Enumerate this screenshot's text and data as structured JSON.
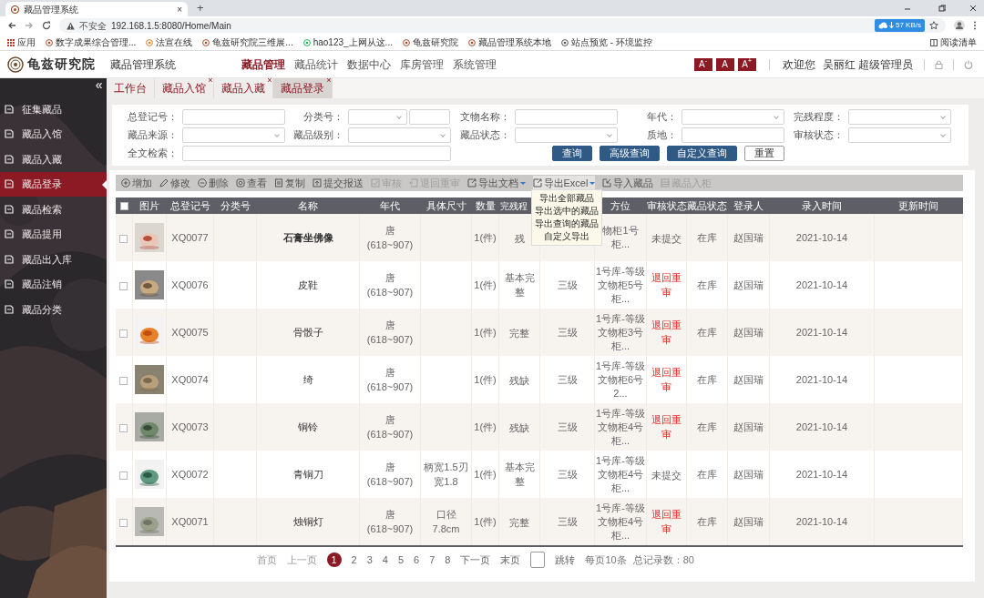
{
  "browser": {
    "tab_title": "藏品管理系统",
    "tab_close": "×",
    "new_tab": "+",
    "security": "不安全",
    "url": "192.168.1.5:8080/Home/Main",
    "speed": "57 KB/s",
    "bookmarks": [
      "应用",
      "数字成果综合管理...",
      "法宣在线",
      "龟兹研究院三维展...",
      "hao123_上网从这...",
      "龟兹研究院",
      "藏品管理系统本地",
      "站点预览 - 环境监控"
    ],
    "reading_list": "阅读清单"
  },
  "header": {
    "logo": "龟兹研究院",
    "system_name": "藏品管理系统",
    "nav": [
      {
        "label": "藏品管理",
        "selected": true
      },
      {
        "label": "藏品统计",
        "selected": false
      },
      {
        "label": "数据中心",
        "selected": false
      },
      {
        "label": "库房管理",
        "selected": false
      },
      {
        "label": "系统管理",
        "selected": false
      }
    ],
    "font_sizes": [
      "A$^{-}$",
      "A",
      "A$^{+}$"
    ],
    "welcome": "欢迎您",
    "user": "吴丽红 超级管理员"
  },
  "sidebar": {
    "collapse": "«",
    "items": [
      {
        "label": "征集藏品",
        "selected": false
      },
      {
        "label": "藏品入馆",
        "selected": false
      },
      {
        "label": "藏品入藏",
        "selected": false
      },
      {
        "label": "藏品登录",
        "selected": true
      },
      {
        "label": "藏品检索",
        "selected": false
      },
      {
        "label": "藏品提用",
        "selected": false
      },
      {
        "label": "藏品出入库",
        "selected": false
      },
      {
        "label": "藏品注销",
        "selected": false
      },
      {
        "label": "藏品分类",
        "selected": false
      }
    ]
  },
  "tabs": [
    {
      "label": "工作台",
      "selected": false
    },
    {
      "label": "藏品入馆",
      "selected": false,
      "close": "×"
    },
    {
      "label": "藏品入藏",
      "selected": false,
      "close": "×"
    },
    {
      "label": "藏品登录",
      "selected": true,
      "close": "×"
    }
  ],
  "filters": [
    {
      "label": "总登记号：",
      "kind": "text"
    },
    {
      "label": "分类号：",
      "kind": "select_text"
    },
    {
      "label": "文物名称：",
      "kind": "text"
    },
    {
      "label": "年代：",
      "kind": "select"
    },
    {
      "label": "完残程度：",
      "kind": "select"
    },
    {
      "label": "藏品来源：",
      "kind": "select"
    },
    {
      "label": "藏品级别：",
      "kind": "select"
    },
    {
      "label": "藏品状态：",
      "kind": "select"
    },
    {
      "label": "质地：",
      "kind": "text"
    },
    {
      "label": "审核状态：",
      "kind": "select"
    },
    {
      "label": "全文检索：",
      "kind": "wide"
    }
  ],
  "search_buttons": [
    {
      "label": "查询",
      "kind": "primary"
    },
    {
      "label": "高级查询",
      "kind": "primary"
    },
    {
      "label": "自定义查询",
      "kind": "primary"
    },
    {
      "label": "重置",
      "kind": "plain"
    }
  ],
  "toolbar": [
    {
      "label": "增加",
      "kind": "add",
      "disabled": false
    },
    {
      "label": "修改",
      "kind": "edit",
      "disabled": false
    },
    {
      "label": "删除",
      "kind": "delete",
      "disabled": false
    },
    {
      "label": "查看",
      "kind": "view",
      "disabled": false
    },
    {
      "label": "复制",
      "kind": "copy",
      "disabled": false
    },
    {
      "label": "提交报送",
      "kind": "submit",
      "disabled": false
    },
    {
      "label": "审核",
      "kind": "audit",
      "disabled": true
    },
    {
      "label": "退回重审",
      "kind": "return",
      "disabled": true
    },
    {
      "label": "导出文档",
      "kind": "export",
      "disabled": false,
      "dropdown": true
    },
    {
      "label": "导出Excel",
      "kind": "export",
      "disabled": false,
      "dropdown": true,
      "expanded": true,
      "menu": [
        "导出全部藏品",
        "导出选中的藏品",
        "导出查询的藏品",
        "自定义导出"
      ]
    },
    {
      "label": "导入藏品",
      "kind": "import",
      "disabled": false
    },
    {
      "label": "藏品入柜",
      "kind": "cabinet",
      "disabled": true
    }
  ],
  "table": {
    "all_checked": false,
    "columns": [
      "图片",
      "总登记号",
      "分类号",
      "名称",
      "年代",
      "具体尺寸",
      "数量",
      "完残程",
      null,
      "方位",
      "审核状态",
      "藏品状态",
      "登录人",
      "录入时间",
      "更新时间"
    ],
    "rows": [
      {
        "checked": false,
        "selected": true,
        "reg_no": "XQ0077",
        "name": "石膏坐佛像",
        "era": "唐(618~907)",
        "quantity": "1(件)",
        "completeness": "残",
        "location": "物柜1号柜...",
        "audit": "未提交",
        "returned": false,
        "status": "在库",
        "registrant": "赵国瑞",
        "entry_time": "2021-10-14"
      },
      {
        "checked": false,
        "selected": false,
        "reg_no": "XQ0076",
        "name": "皮鞋",
        "era": "唐(618~907)",
        "quantity": "1(件)",
        "completeness": "基本完整",
        "grade": "三级",
        "location": "1号库-等级文物柜5号柜...",
        "audit": "退回重审",
        "returned": true,
        "status": "在库",
        "registrant": "赵国瑞",
        "entry_time": "2021-10-14"
      },
      {
        "checked": false,
        "selected": false,
        "reg_no": "XQ0075",
        "name": "骨骰子",
        "era": "唐(618~907)",
        "quantity": "1(件)",
        "completeness": "完整",
        "grade": "三级",
        "location": "1号库-等级文物柜3号柜...",
        "audit": "退回重审",
        "returned": true,
        "status": "在库",
        "registrant": "赵国瑞",
        "entry_time": "2021-10-14"
      },
      {
        "checked": false,
        "selected": false,
        "reg_no": "XQ0074",
        "name": "绮",
        "era": "唐(618~907)",
        "quantity": "1(件)",
        "completeness": "残缺",
        "grade": "三级",
        "location": "1号库-等级文物柜6号2...",
        "audit": "退回重审",
        "returned": true,
        "status": "在库",
        "registrant": "赵国瑞",
        "entry_time": "2021-10-14"
      },
      {
        "checked": false,
        "selected": false,
        "reg_no": "XQ0073",
        "name": "铜铃",
        "era": "唐(618~907)",
        "quantity": "1(件)",
        "completeness": "残缺",
        "grade": "三级",
        "location": "1号库-等级文物柜4号柜...",
        "audit": "退回重审",
        "returned": true,
        "status": "在库",
        "registrant": "赵国瑞",
        "entry_time": "2021-10-14"
      },
      {
        "checked": false,
        "selected": false,
        "reg_no": "XQ0072",
        "name": "青铜刀",
        "era": "唐(618~907)",
        "size": "柄宽1.5刃宽1.8",
        "quantity": "1(件)",
        "completeness": "基本完整",
        "grade": "三级",
        "location": "1号库-等级文物柜4号柜...",
        "audit": "未提交",
        "returned": false,
        "status": "在库",
        "registrant": "赵国瑞",
        "entry_time": "2021-10-14"
      },
      {
        "checked": false,
        "selected": false,
        "reg_no": "XQ0071",
        "name": "烛铜灯",
        "era": "唐(618~907)",
        "size": "口径7.8cm",
        "quantity": "1(件)",
        "completeness": "完整",
        "grade": "三级",
        "location": "1号库-等级文物柜4号柜...",
        "audit": "退回重审",
        "returned": true,
        "status": "在库",
        "registrant": "赵国瑞",
        "entry_time": "2021-10-14"
      }
    ]
  },
  "pagination": {
    "first": "首页",
    "prev": "上一页",
    "pages": [
      {
        "label": "1",
        "selected": true
      },
      {
        "label": "2",
        "selected": false
      },
      {
        "label": "3",
        "selected": false
      },
      {
        "label": "4",
        "selected": false
      },
      {
        "label": "5",
        "selected": false
      },
      {
        "label": "6",
        "selected": false
      },
      {
        "label": "7",
        "selected": false
      },
      {
        "label": "8",
        "selected": false
      }
    ],
    "next": "下一页",
    "last": "末页",
    "jump": "跳转",
    "per_page": "每页10条",
    "total": "总记录数：80"
  }
}
